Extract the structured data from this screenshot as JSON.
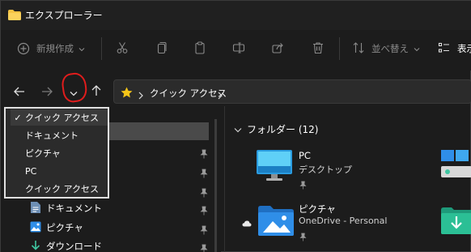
{
  "window": {
    "title": "エクスプローラー"
  },
  "toolbar": {
    "new_label": "新規作成",
    "sort_label": "並べ替え",
    "view_label": "表示"
  },
  "address": {
    "path": "クイック アクセス"
  },
  "dropdown": {
    "items": [
      {
        "label": "クイック アクセス",
        "selected": true
      },
      {
        "label": "ドキュメント",
        "selected": false
      },
      {
        "label": "ピクチャ",
        "selected": false
      },
      {
        "label": "PC",
        "selected": false
      },
      {
        "label": "クイック アクセス",
        "selected": false
      }
    ]
  },
  "sidebar": {
    "items": [
      {
        "label": "ドキュメント",
        "icon": "document-icon"
      },
      {
        "label": "ピクチャ",
        "icon": "picture-icon"
      },
      {
        "label": "ダウンロード",
        "icon": "download-icon"
      }
    ]
  },
  "content": {
    "group_title": "フォルダー (12)",
    "tiles": [
      {
        "name": "PC",
        "sub": "デスクトップ",
        "icon": "desktop-folder-icon"
      },
      {
        "name": "ピクチャ",
        "sub": "OneDrive - Personal",
        "icon": "pictures-folder-icon"
      }
    ]
  },
  "colors": {
    "background": "#1c1c1c",
    "dropdown_bg": "#2b2b2b",
    "annotation": "#e01c1c",
    "folder_blue": "#2f8ee8",
    "star": "#f5c518"
  }
}
